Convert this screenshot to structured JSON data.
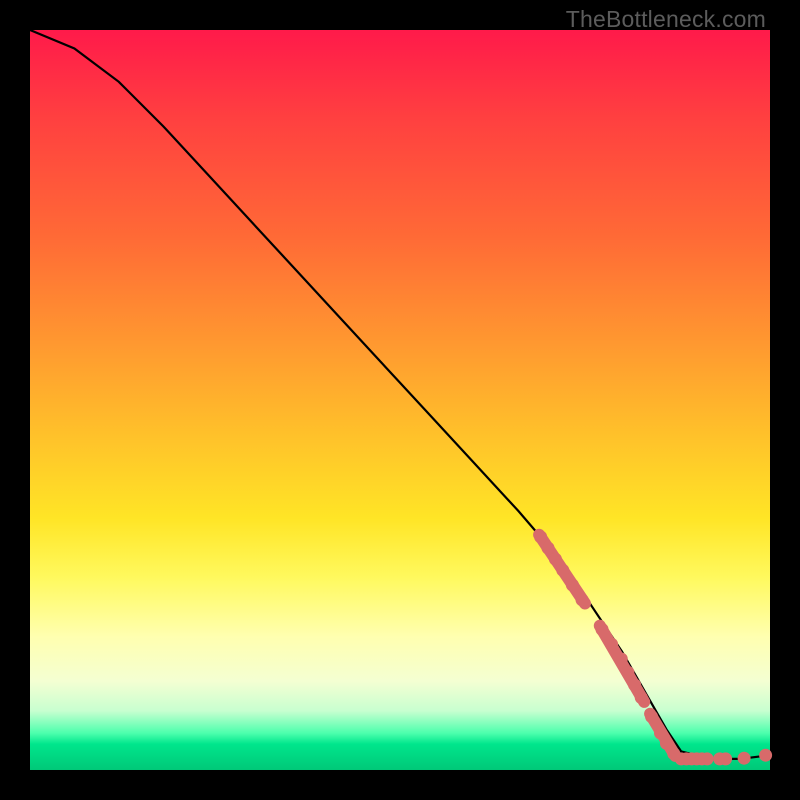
{
  "watermark": "TheBottleneck.com",
  "chart_data": {
    "type": "line",
    "title": "",
    "xlabel": "",
    "ylabel": "",
    "xlim": [
      0,
      100
    ],
    "ylim": [
      0,
      100
    ],
    "grid": false,
    "series": [
      {
        "name": "curve",
        "color": "#000000",
        "x": [
          0,
          6,
          12,
          18,
          24,
          30,
          36,
          42,
          48,
          54,
          60,
          66,
          72,
          76,
          80,
          84,
          86,
          88,
          92,
          96,
          100
        ],
        "y": [
          100,
          97.5,
          93,
          87,
          80.5,
          74,
          67.5,
          61,
          54.5,
          48,
          41.5,
          35,
          28,
          22,
          16,
          9,
          5.5,
          2.5,
          1.5,
          1.5,
          2
        ]
      }
    ],
    "markers": [
      {
        "x": 69,
        "y": 31.5
      },
      {
        "x": 70,
        "y": 30
      },
      {
        "x": 71,
        "y": 28.5
      },
      {
        "x": 72,
        "y": 27
      },
      {
        "x": 73.3,
        "y": 25
      },
      {
        "x": 74.6,
        "y": 23
      },
      {
        "x": 77.3,
        "y": 19
      },
      {
        "x": 78.6,
        "y": 17
      },
      {
        "x": 79.9,
        "y": 15
      },
      {
        "x": 80.8,
        "y": 13.2
      },
      {
        "x": 81.7,
        "y": 11.5
      },
      {
        "x": 82.6,
        "y": 9.8
      },
      {
        "x": 84,
        "y": 7.2
      },
      {
        "x": 85.2,
        "y": 5
      },
      {
        "x": 86,
        "y": 3.6
      },
      {
        "x": 87,
        "y": 2.2
      },
      {
        "x": 88,
        "y": 1.5
      },
      {
        "x": 88.7,
        "y": 1.5
      },
      {
        "x": 89.4,
        "y": 1.5
      },
      {
        "x": 90.1,
        "y": 1.5
      },
      {
        "x": 90.8,
        "y": 1.5
      },
      {
        "x": 91.5,
        "y": 1.5
      },
      {
        "x": 93.2,
        "y": 1.5
      },
      {
        "x": 94,
        "y": 1.5
      },
      {
        "x": 96.5,
        "y": 1.6
      },
      {
        "x": 99.4,
        "y": 2
      }
    ],
    "dashes": [
      {
        "x1": 68.8,
        "y1": 31.8,
        "x2": 75,
        "y2": 22.5
      },
      {
        "x1": 77,
        "y1": 19.5,
        "x2": 83,
        "y2": 9.2
      },
      {
        "x1": 83.8,
        "y1": 7.6,
        "x2": 87.2,
        "y2": 1.9
      }
    ]
  }
}
